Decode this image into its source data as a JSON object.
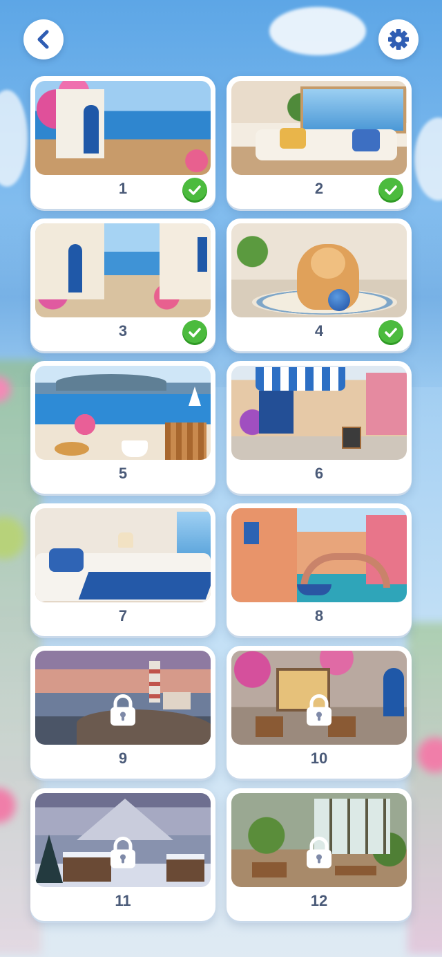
{
  "header": {
    "back_icon": "chevron-left-icon",
    "settings_icon": "gear-icon",
    "accent_color": "#2f5db3"
  },
  "levels": [
    {
      "number": "1",
      "status": "completed",
      "scene": "terrace-bougainvillea-sea"
    },
    {
      "number": "2",
      "status": "completed",
      "scene": "living-room-sea-view"
    },
    {
      "number": "3",
      "status": "completed",
      "scene": "seaside-alley"
    },
    {
      "number": "4",
      "status": "completed",
      "scene": "puppy-with-ball"
    },
    {
      "number": "5",
      "status": "unlocked",
      "scene": "breakfast-sailboat"
    },
    {
      "number": "6",
      "status": "unlocked",
      "scene": "cafe-awning-street"
    },
    {
      "number": "7",
      "status": "unlocked",
      "scene": "bedroom"
    },
    {
      "number": "8",
      "status": "unlocked",
      "scene": "canal-bridge"
    },
    {
      "number": "9",
      "status": "locked",
      "scene": "lighthouse-sunset"
    },
    {
      "number": "10",
      "status": "locked",
      "scene": "flower-courtyard-cafe"
    },
    {
      "number": "11",
      "status": "locked",
      "scene": "snowy-cabins"
    },
    {
      "number": "12",
      "status": "locked",
      "scene": "greenhouse"
    }
  ],
  "status_colors": {
    "completed": "#4cbb3e",
    "locked_overlay": "#ffffff"
  }
}
